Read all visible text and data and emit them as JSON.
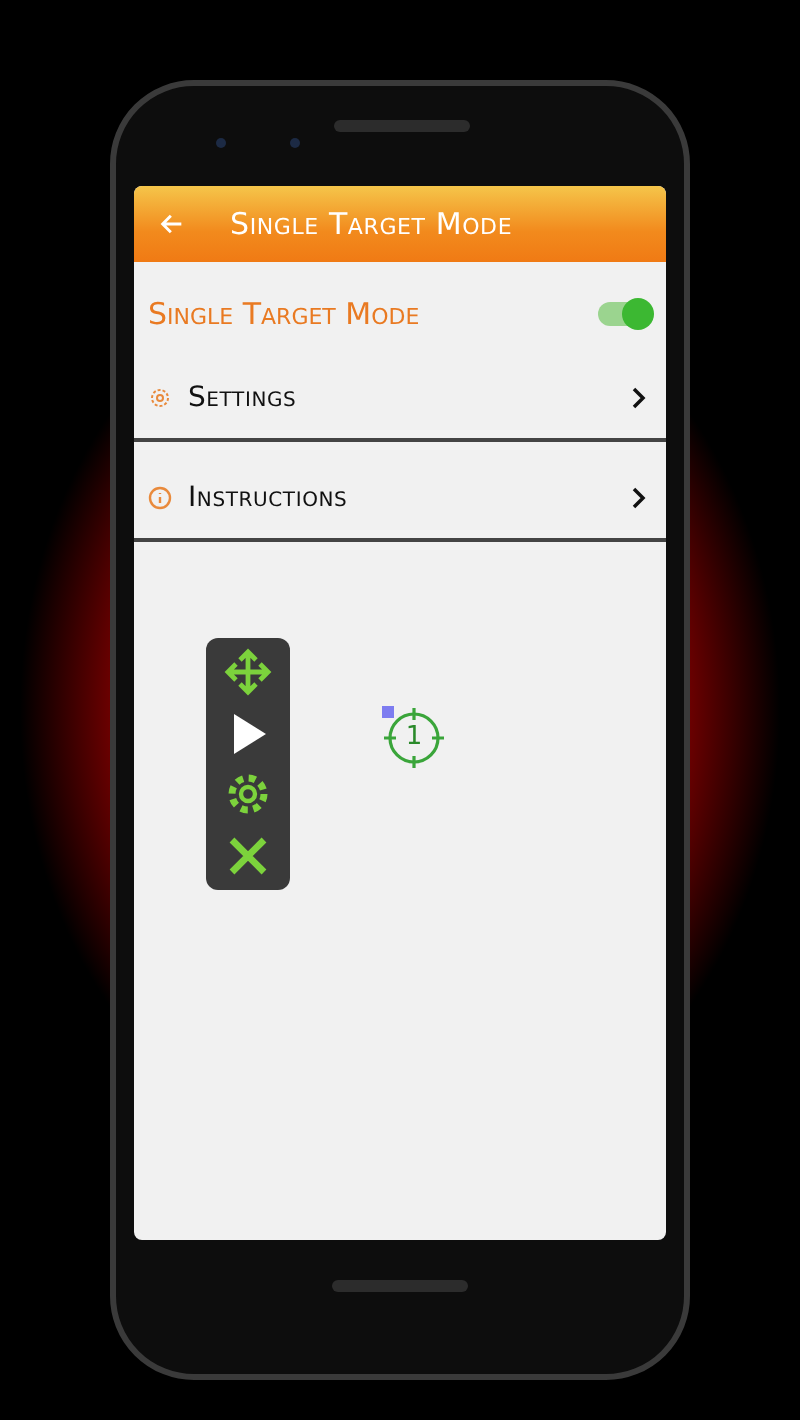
{
  "header": {
    "title": "Single Target Mode"
  },
  "mode": {
    "label": "Single Target Mode",
    "on": true
  },
  "menu": [
    {
      "kind": "settings",
      "label": "Settings"
    },
    {
      "kind": "info",
      "label": "Instructions"
    }
  ],
  "target": {
    "number": "1"
  }
}
